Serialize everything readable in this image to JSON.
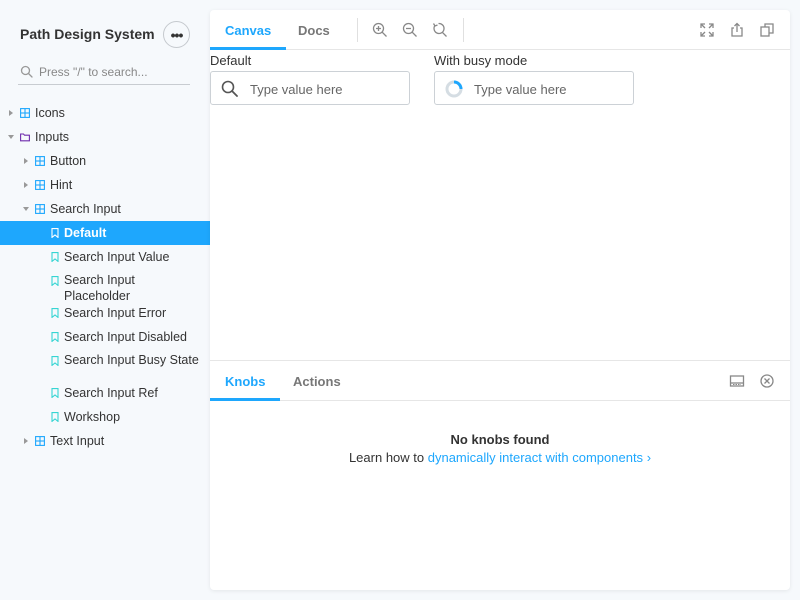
{
  "sidebar": {
    "brand": "Path Design System",
    "menu_label": "•••",
    "search_placeholder": "Press \"/\" to search...",
    "tree": [
      {
        "label": "Icons",
        "type": "component",
        "level": 0,
        "expanded": false
      },
      {
        "label": "Inputs",
        "type": "folder",
        "level": 0,
        "expanded": true
      },
      {
        "label": "Button",
        "type": "component",
        "level": 1,
        "expanded": false
      },
      {
        "label": "Hint",
        "type": "component",
        "level": 1,
        "expanded": false
      },
      {
        "label": "Search Input",
        "type": "component",
        "level": 1,
        "expanded": true
      },
      {
        "label": "Default",
        "type": "story",
        "level": 2,
        "selected": true
      },
      {
        "label": "Search Input Value",
        "type": "story",
        "level": 2
      },
      {
        "label": "Search Input Placeholder",
        "type": "story",
        "level": 2
      },
      {
        "label": "Search Input Error",
        "type": "story",
        "level": 2
      },
      {
        "label": "Search Input Disabled",
        "type": "story",
        "level": 2
      },
      {
        "label": "Search Input Busy State",
        "type": "story",
        "level": 2
      },
      {
        "label": "Search Input Ref",
        "type": "story",
        "level": 2
      },
      {
        "label": "Workshop",
        "type": "story",
        "level": 2
      },
      {
        "label": "Text Input",
        "type": "component",
        "level": 1,
        "expanded": false
      }
    ]
  },
  "toolbar": {
    "tabs": [
      {
        "label": "Canvas",
        "active": true
      },
      {
        "label": "Docs",
        "active": false
      }
    ],
    "tools": [
      "zoom-in-icon",
      "zoom-out-icon",
      "reset-zoom-icon"
    ],
    "right_tools": [
      "fullscreen-icon",
      "share-icon",
      "copy-link-icon"
    ]
  },
  "story": {
    "default_label": "Default",
    "default_placeholder": "Type value here",
    "busy_label": "With busy mode",
    "busy_placeholder": "Type value here"
  },
  "addons": {
    "tabs": [
      {
        "label": "Knobs",
        "active": true
      },
      {
        "label": "Actions",
        "active": false
      }
    ],
    "no_knobs_title": "No knobs found",
    "learn_prefix": "Learn how to ",
    "learn_link": "dynamically interact with components",
    "learn_chevron": "›"
  },
  "colors": {
    "accent": "#1ea7fd",
    "component_icon": "#1ea7fd",
    "folder_icon": "#6f2cac",
    "story_icon": "#37d5d3"
  }
}
